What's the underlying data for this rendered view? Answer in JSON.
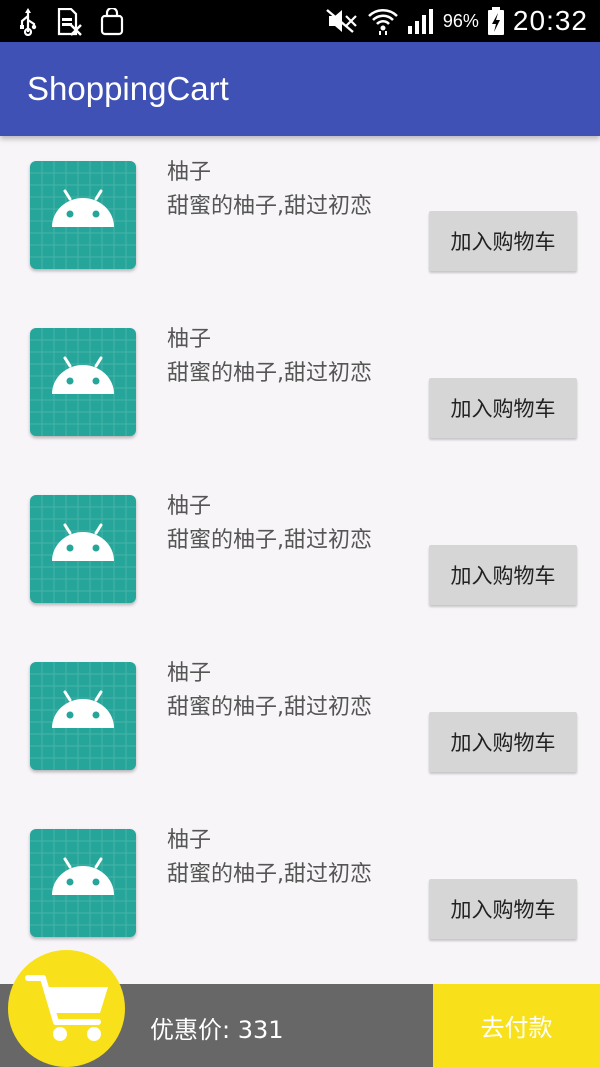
{
  "status_bar": {
    "battery_percent": "96%",
    "time": "20:32",
    "left_icons": [
      "usb-icon",
      "sim-icon",
      "shopping-bag-icon"
    ],
    "right_icons": [
      "mute-icon",
      "wifi-icon",
      "signal-icon",
      "battery-icon"
    ]
  },
  "app_bar": {
    "title": "ShoppingCart"
  },
  "colors": {
    "primary": "#3f51b5",
    "accent": "#f8e11a",
    "bottom_bar": "#676767",
    "thumbnail": "#26a69a",
    "button": "#d6d6d6"
  },
  "products": [
    {
      "name": "柚子",
      "description": "甜蜜的柚子,甜过初恋",
      "button_label": "加入购物车",
      "icon": "android-icon"
    },
    {
      "name": "柚子",
      "description": "甜蜜的柚子,甜过初恋",
      "button_label": "加入购物车",
      "icon": "android-icon"
    },
    {
      "name": "柚子",
      "description": "甜蜜的柚子,甜过初恋",
      "button_label": "加入购物车",
      "icon": "android-icon"
    },
    {
      "name": "柚子",
      "description": "甜蜜的柚子,甜过初恋",
      "button_label": "加入购物车",
      "icon": "android-icon"
    },
    {
      "name": "柚子",
      "description": "甜蜜的柚子,甜过初恋",
      "button_label": "加入购物车",
      "icon": "android-icon"
    }
  ],
  "bottom_bar": {
    "price_text": "优惠价: 331",
    "checkout_label": "去付款",
    "cart_icon": "shopping-cart-icon"
  }
}
